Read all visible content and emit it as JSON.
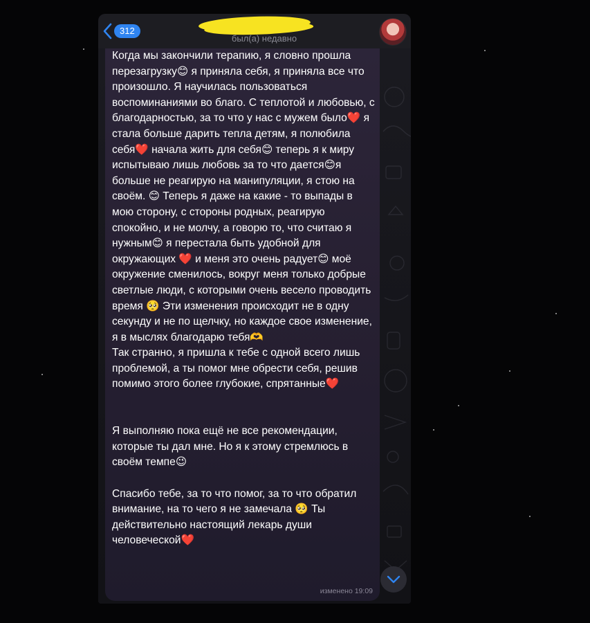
{
  "header": {
    "unread_count": "312",
    "last_seen": "был(а) недавно",
    "icons": {
      "back": "chevron-left-icon",
      "scroll_down": "chevron-down-icon"
    }
  },
  "message": {
    "text": "Когда мы закончили терапию, я словно прошла перезагрузку😊 я приняла себя, я приняла все что произошло. Я научилась пользоваться воспоминаниями во благо. С теплотой и любовью, с благодарностью, за то что у нас с мужем было❤️ я стала больше дарить тепла детям, я полюбила себя❤️ начала жить для себя😊 теперь я к миру испытываю лишь любовь за то что дается😊я больше не реагирую на манипуляции, я стою на своём. 😊 Теперь я даже на какие - то выпады в мою сторону, с стороны родных, реагирую спокойно, и не молчу, а говорю то, что считаю я нужным😊 я перестала быть удобной для окружающих ❤️ и меня это очень радует😊 моё окружение сменилось, вокруг меня только добрые светлые люди, с которыми очень весело проводить время 🥺 Эти изменения происходит не в одну секунду и не по щелчку, но каждое свое изменение, я в мыслях благодарю тебя🫶\nТак странно, я пришла к тебе с одной всего лишь проблемой, а ты помог мне обрести себя, решив помимо этого более глубокие, спрятанные❤️\n\n\nЯ выполняю пока ещё не все рекомендации, которые ты дал мне. Но я к этому стремлюсь в своём темпе😉\n\nСпасибо тебе, за то что помог, за то что обратил внимание, на то чего я не замечала 🥺 Ты действительно настоящий лекарь души человеческой❤️",
    "status": "изменено",
    "time": "19:09"
  },
  "colors": {
    "badge": "#2f84f0",
    "redaction": "#f7e321",
    "bubble": "#2a2336",
    "background": "#050506"
  }
}
